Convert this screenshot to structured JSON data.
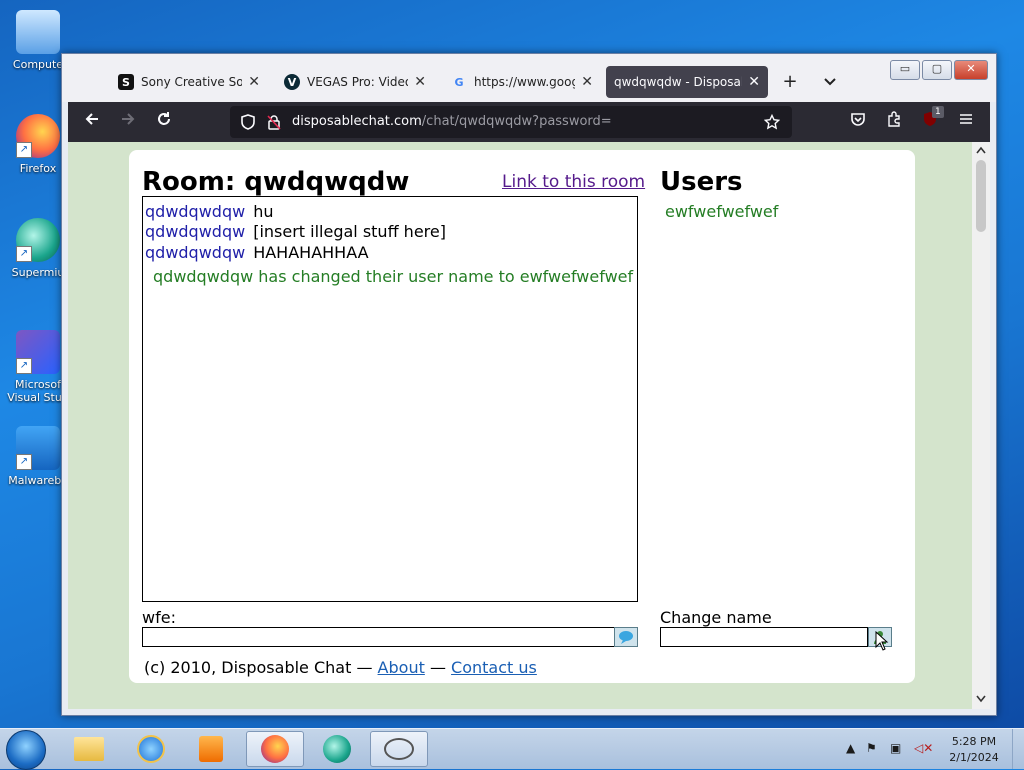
{
  "desktop": {
    "icons": [
      {
        "label": "Compute",
        "icon": "computer-icon"
      },
      {
        "label": "Firefox",
        "icon": "firefox-icon"
      },
      {
        "label": "Supermiu",
        "icon": "supermium-icon"
      },
      {
        "label": "Microsof Visual Stud",
        "icon": "visual-studio-icon"
      },
      {
        "label": "Malwareby",
        "icon": "malwarebytes-icon"
      }
    ]
  },
  "browser": {
    "tabs": [
      {
        "title": "Sony Creative Softw",
        "favicon": "S"
      },
      {
        "title": "VEGAS Pro: Video Ed",
        "favicon": "V"
      },
      {
        "title": "https://www.google.",
        "favicon": "G"
      },
      {
        "title": "qwdqwqdw - Disposable",
        "favicon": ""
      }
    ],
    "new_tab": "+",
    "tab_list": "⌄",
    "url_host": "disposablechat.com",
    "url_path": "/chat/qwdqwqdw?password=",
    "extension_badge": "1"
  },
  "page": {
    "room_title": "Room: qwdqwqdw",
    "room_link": "Link to this room",
    "messages": [
      {
        "user": "qdwdqwdqw",
        "text": "hu"
      },
      {
        "user": "qdwdqwdqw",
        "text": "[insert illegal stuff here]"
      },
      {
        "user": "qdwdqwdqw",
        "text": "HAHAHAHHAA"
      }
    ],
    "system_message": "qdwdqwdqw has changed their user name to ewfwefwefwef",
    "users_heading": "Users",
    "users": [
      "ewfwefwefwef"
    ],
    "message_label": "wfe:",
    "message_value": "",
    "change_name_label": "Change name",
    "change_name_value": "",
    "footer": {
      "copyright": "(c) 2010, Disposable Chat —",
      "about": "About",
      "sep": "—",
      "contact": "Contact us"
    }
  },
  "taskbar": {
    "clock_time": "5:28 PM",
    "clock_date": "2/1/2024"
  }
}
